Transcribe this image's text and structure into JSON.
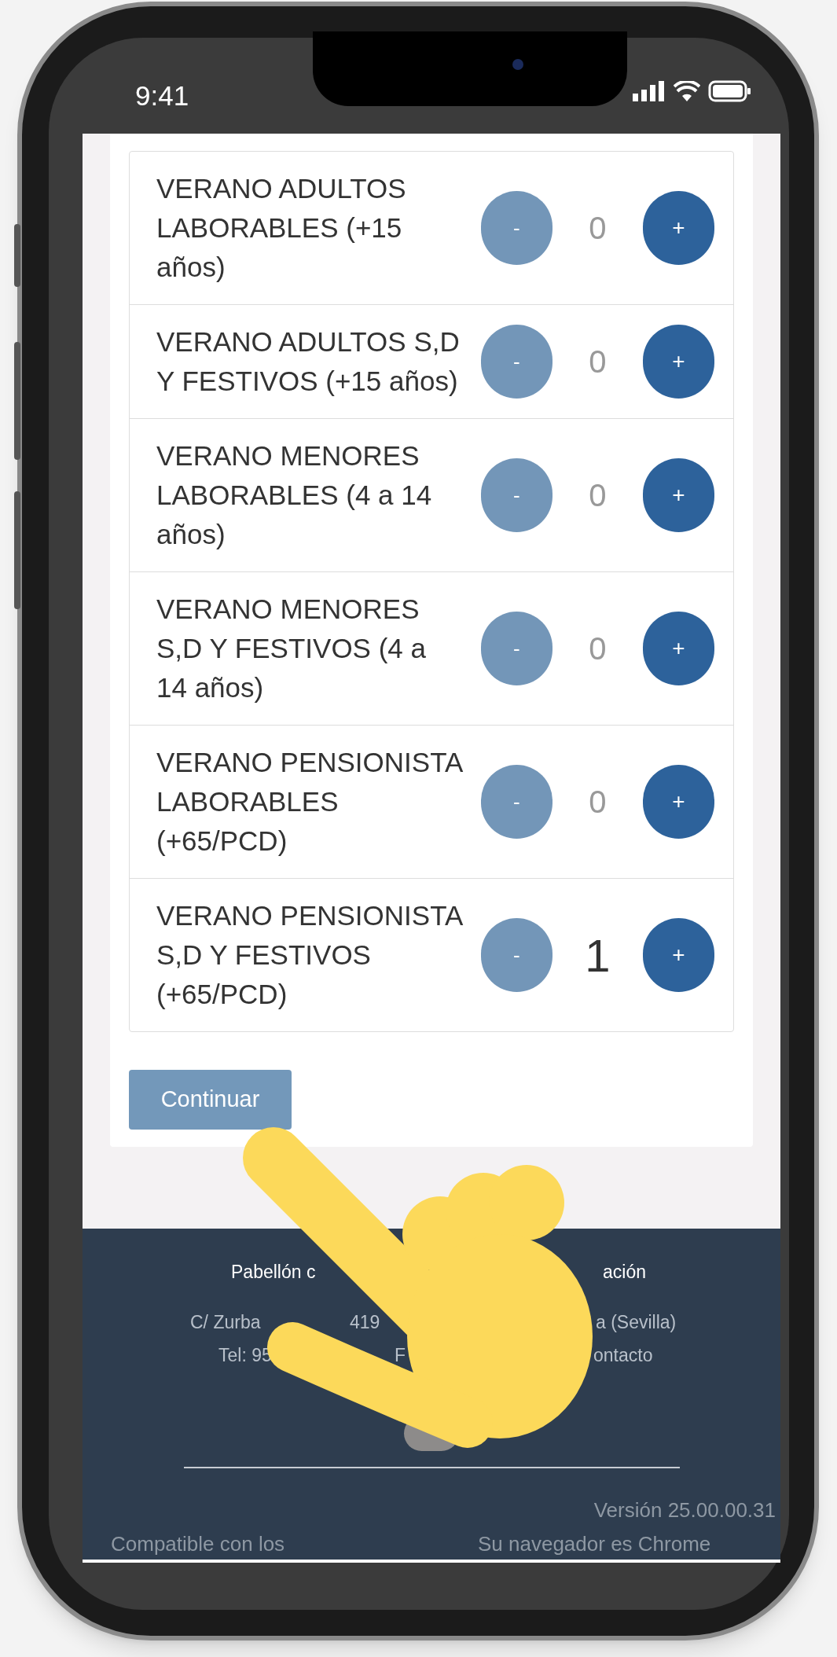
{
  "status_bar": {
    "time": "9:41"
  },
  "tickets": [
    {
      "label": "VERANO ADULTOS LABORABLES (+15 años)",
      "minus": "-",
      "quantity": "0",
      "plus": "+",
      "emphasized": false
    },
    {
      "label": "VERANO ADULTOS S,D Y FESTIVOS (+15 años)",
      "minus": "-",
      "quantity": "0",
      "plus": "+",
      "emphasized": false
    },
    {
      "label": "VERANO MENORES LABORABLES (4 a 14 años)",
      "minus": "-",
      "quantity": "0",
      "plus": "+",
      "emphasized": false
    },
    {
      "label": "VERANO MENORES S,D Y FESTIVOS (4 a 14 años)",
      "minus": "-",
      "quantity": "0",
      "plus": "+",
      "emphasized": false
    },
    {
      "label": "VERANO PENSIONISTA LABORABLES (+65/PCD)",
      "minus": "-",
      "quantity": "0",
      "plus": "+",
      "emphasized": false
    },
    {
      "label": "VERANO PENSIONISTA S,D Y FESTIVOS (+65/PCD)",
      "minus": "-",
      "quantity": "1",
      "plus": "+",
      "emphasized": true
    }
  ],
  "continue_button": "Continuar",
  "footer": {
    "lines": [
      [
        "Pabellón c",
        "ación"
      ],
      [
        "C/ Zurba",
        "419",
        "a (Sevilla)"
      ],
      [
        "Tel: 95",
        "F",
        "ontacto"
      ]
    ],
    "version": "Versión 25.00.00.31",
    "bottom_left": "Compatible con los",
    "bottom_right": "Su navegador es Chrome"
  }
}
